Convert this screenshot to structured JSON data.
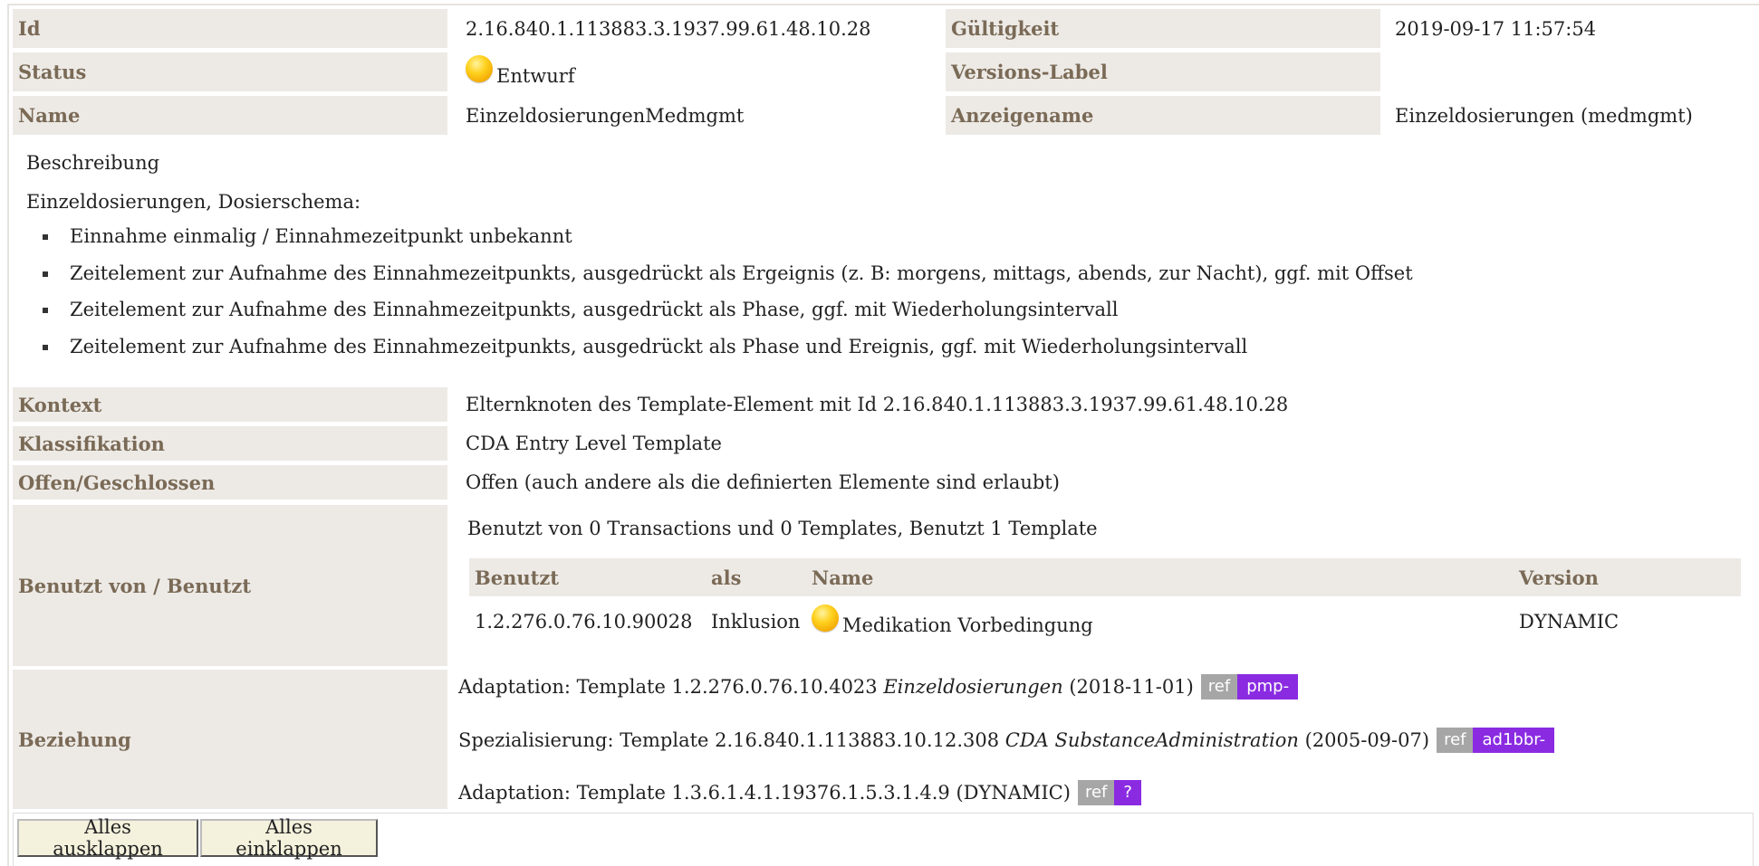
{
  "header": {
    "id_label": "Id",
    "id_value": "2.16.840.1.113883.3.1937.99.61.48.10.28",
    "validity_label": "Gültigkeit",
    "validity_value": "2019-09-17 11:57:54",
    "status_label": "Status",
    "status_value": "Entwurf",
    "version_label": "Versions-Label",
    "version_value": "",
    "name_label": "Name",
    "name_value": "EinzeldosierungenMedmgmt",
    "display_label": "Anzeigename",
    "display_value": "Einzeldosierungen (medmgmt)"
  },
  "description": {
    "heading": "Beschreibung",
    "intro": "Einzeldosierungen, Dosierschema:",
    "items": [
      "Einnahme einmalig / Einnahmezeitpunkt unbekannt",
      "Zeitelement zur Aufnahme des Einnahmezeitpunkts, ausgedrückt als Ergeignis (z. B: morgens, mittags, abends, zur Nacht), ggf. mit Offset",
      "Zeitelement zur Aufnahme des Einnahmezeitpunkts, ausgedrückt als Phase, ggf. mit Wiederholungsintervall",
      "Zeitelement zur Aufnahme des Einnahmezeitpunkts, ausgedrückt als Phase und Ereignis, ggf. mit Wiederholungsintervall"
    ]
  },
  "details": {
    "context_label": "Kontext",
    "context_value": "Elternknoten des Template-Element mit Id 2.16.840.1.113883.3.1937.99.61.48.10.28",
    "class_label": "Klassifikation",
    "class_value": "CDA Entry Level Template",
    "open_label": "Offen/Geschlossen",
    "open_value": "Offen (auch andere als die definierten Elemente sind erlaubt)",
    "usage_label": "Benutzt von / Benutzt",
    "usage_summary": "Benutzt von 0 Transactions und 0 Templates, Benutzt 1 Template",
    "usage_table": {
      "headers": [
        "Benutzt",
        "als",
        "Name",
        "Version"
      ],
      "rows": [
        {
          "id": "1.2.276.0.76.10.90028",
          "as": "Inklusion",
          "name": "Medikation Vorbedingung",
          "version": "DYNAMIC"
        }
      ]
    },
    "relation_label": "Beziehung",
    "relations": [
      {
        "prefix": "Adaptation: Template 1.2.276.0.76.10.4023",
        "name": "Einzeldosierungen",
        "suffix": "(2018-11-01)",
        "ref": "ref",
        "tag": "pmp-"
      },
      {
        "prefix": "Spezialisierung: Template 2.16.840.1.113883.10.12.308",
        "name": "CDA SubstanceAdministration",
        "suffix": "(2005-09-07)",
        "ref": "ref",
        "tag": "ad1bbr-"
      },
      {
        "prefix": "Adaptation: Template 1.3.6.1.4.1.19376.1.5.3.1.4.9 (DYNAMIC)",
        "name": "",
        "suffix": "",
        "ref": "ref",
        "tag": "?"
      }
    ]
  },
  "buttons": {
    "expand_all": "Alles ausklappen",
    "collapse_all": "Alles einklappen"
  },
  "colors": {
    "label_bg": "#edeae6",
    "label_text": "#7a6a56",
    "status_dot": "#ffc61a",
    "ref_tag": "#a6a6a6",
    "project_tag": "#8a2be2"
  }
}
